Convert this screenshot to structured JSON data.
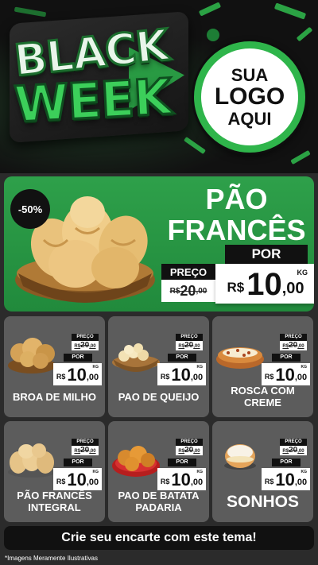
{
  "header": {
    "title_line1": "BLACK",
    "title_line2": "WEEK",
    "logo_line1": "SUA",
    "logo_line2": "LOGO",
    "logo_line3": "AQUI"
  },
  "featured": {
    "badge": "-50%",
    "name_line1": "PÃO",
    "name_line2": "FRANCÊS",
    "preco_label": "PREÇO",
    "old_currency": "R$",
    "old_int": "20",
    "old_dec": ",00",
    "por_label": "POR",
    "currency": "R$",
    "price_int": "10",
    "price_dec": ",00",
    "unit": "KG"
  },
  "products": [
    {
      "name": "BROA DE MILHO",
      "preco_label": "PREÇO",
      "old_currency": "R$",
      "old_int": "20",
      "old_dec": ",00",
      "por_label": "POR",
      "currency": "R$",
      "price_int": "10",
      "price_dec": ",00",
      "unit": "KG",
      "image": "corn-bread-basket"
    },
    {
      "name": "PAO DE QUEIJO",
      "preco_label": "PREÇO",
      "old_currency": "R$",
      "old_int": "20",
      "old_dec": ",00",
      "por_label": "POR",
      "currency": "R$",
      "price_int": "10",
      "price_dec": ",00",
      "unit": "KG",
      "image": "cheese-bread-basket"
    },
    {
      "name": "ROSCA COM CREME",
      "preco_label": "PREÇO",
      "old_currency": "R$",
      "old_int": "20",
      "old_dec": ",00",
      "por_label": "POR",
      "currency": "R$",
      "price_int": "10",
      "price_dec": ",00",
      "unit": "KG",
      "image": "cream-rosca"
    },
    {
      "name": "PÃO FRANCÊS INTEGRAL",
      "preco_label": "PREÇO",
      "old_currency": "R$",
      "old_int": "20",
      "old_dec": ",00",
      "por_label": "POR",
      "currency": "R$",
      "price_int": "10",
      "price_dec": ",00",
      "unit": "KG",
      "image": "wholegrain-bread-pile"
    },
    {
      "name": "PAO DE BATATA PADARIA",
      "preco_label": "PREÇO",
      "old_currency": "R$",
      "old_int": "20",
      "old_dec": ",00",
      "por_label": "POR",
      "currency": "R$",
      "price_int": "10",
      "price_dec": ",00",
      "unit": "KG",
      "image": "potato-bread-plate"
    },
    {
      "name": "SONHOS",
      "preco_label": "PREÇO",
      "old_currency": "R$",
      "old_int": "20",
      "old_dec": ",00",
      "por_label": "POR",
      "currency": "R$",
      "price_int": "10",
      "price_dec": ",00",
      "unit": "KG",
      "image": "sonho-pastry"
    }
  ],
  "cta": {
    "label": "Crie seu encarte com este tema!"
  },
  "footer": {
    "note": "*Imagens Meramente Ilustrativas"
  },
  "colors": {
    "accent_green": "#2ea04a",
    "card_gray": "#5c5c5c",
    "dark": "#111111"
  }
}
